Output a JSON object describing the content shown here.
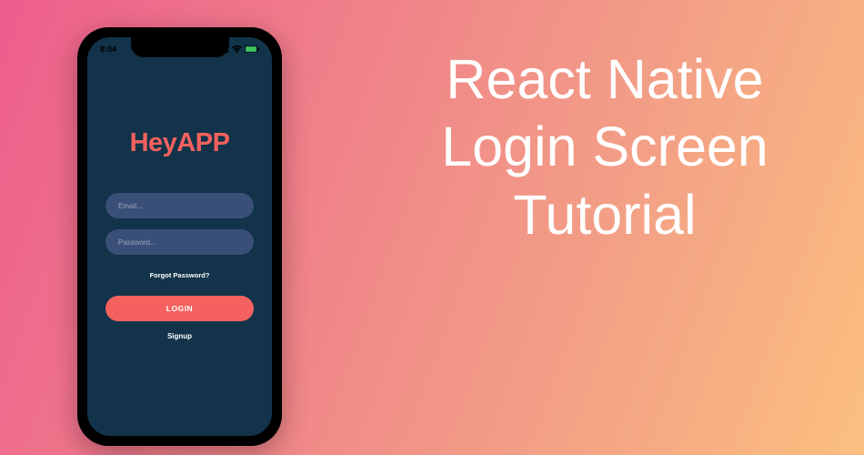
{
  "headline": "React Native Login Screen Tutorial",
  "phone": {
    "status": {
      "time": "8:04"
    },
    "app": {
      "logo": "HeyAPP",
      "emailPlaceholder": "Email...",
      "passwordPlaceholder": "Password...",
      "forgotText": "Forgot Password?",
      "loginLabel": "LOGIN",
      "signupLabel": "Signup"
    }
  },
  "colors": {
    "screenBg": "#12334a",
    "accent": "#f4615e",
    "inputBg": "#3a4f77"
  }
}
